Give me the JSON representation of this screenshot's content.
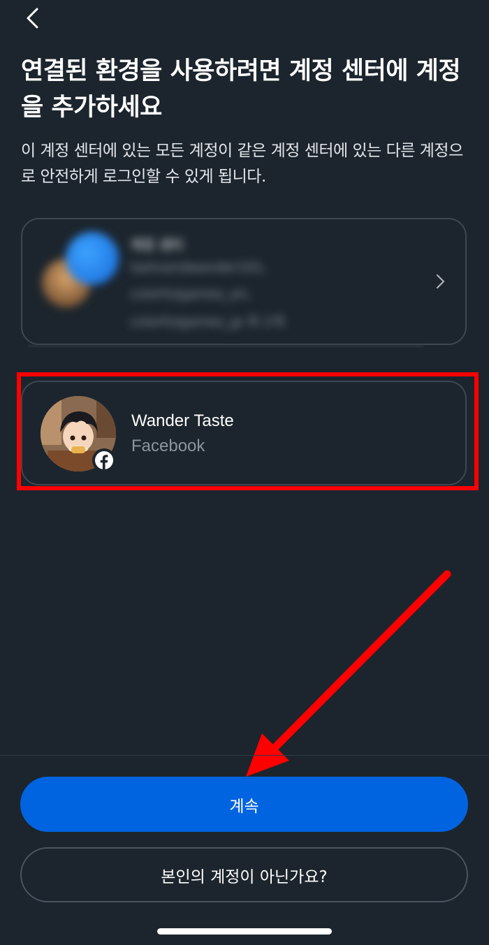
{
  "header": {
    "back_icon": "chevron-left-icon"
  },
  "title": "연결된 환경을 사용하려면 계정 센터에 계정을 추가하세요",
  "subtitle": "이 계정 센터에 있는 모든 계정이 같은 계정 센터에 있는 다른 계정으로 안전하게 로그인할 수 있게 됩니다.",
  "accounts_center_card": {
    "label": "계정 센터",
    "line1": "tastvandwander101,",
    "line2": "colorfulgames_en,",
    "line3": "colorfulgames_jp 외 2개",
    "chevron_icon": "chevron-right-icon"
  },
  "account": {
    "name": "Wander Taste",
    "source": "Facebook",
    "badge_icon": "facebook-icon"
  },
  "annotation": {
    "highlight_color": "#ff0000",
    "arrow_color": "#ff0000"
  },
  "buttons": {
    "continue_label": "계속",
    "not_you_label": "본인의 계정이 아닌가요?"
  },
  "colors": {
    "background": "#1c252d",
    "primary": "#0064e0",
    "secondary_text": "#8d949e"
  }
}
